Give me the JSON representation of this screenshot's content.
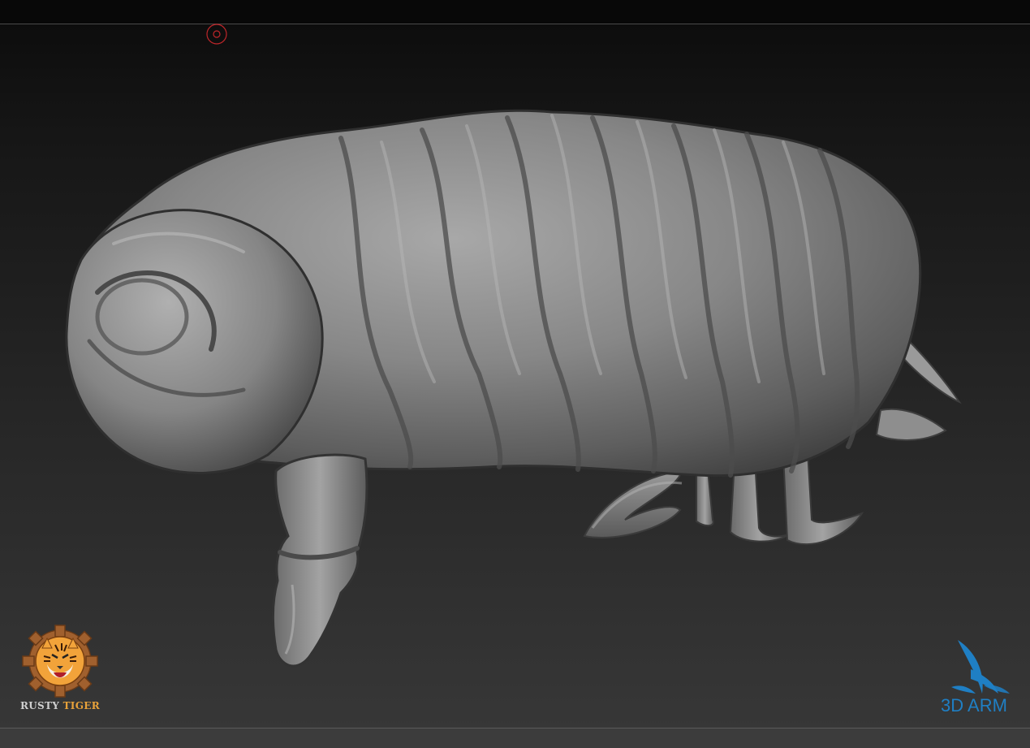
{
  "viewport": {
    "background_top": "#0b0b0b",
    "background_bottom": "#383838"
  },
  "cursor": {
    "icon": "brush-cursor-icon",
    "color": "#c0262a"
  },
  "model": {
    "icon": "tardigrade-sculpt-icon",
    "color": "#8a8a8a"
  },
  "logos": {
    "rusty_tiger": {
      "icon": "tiger-gear-icon",
      "word1": "RUSTY",
      "word2": "TIGER",
      "accent": "#e8a23a"
    },
    "three_d_arm": {
      "icon": "wave-arm-icon",
      "text": "3D ARM",
      "color": "#1f7fc4"
    }
  }
}
